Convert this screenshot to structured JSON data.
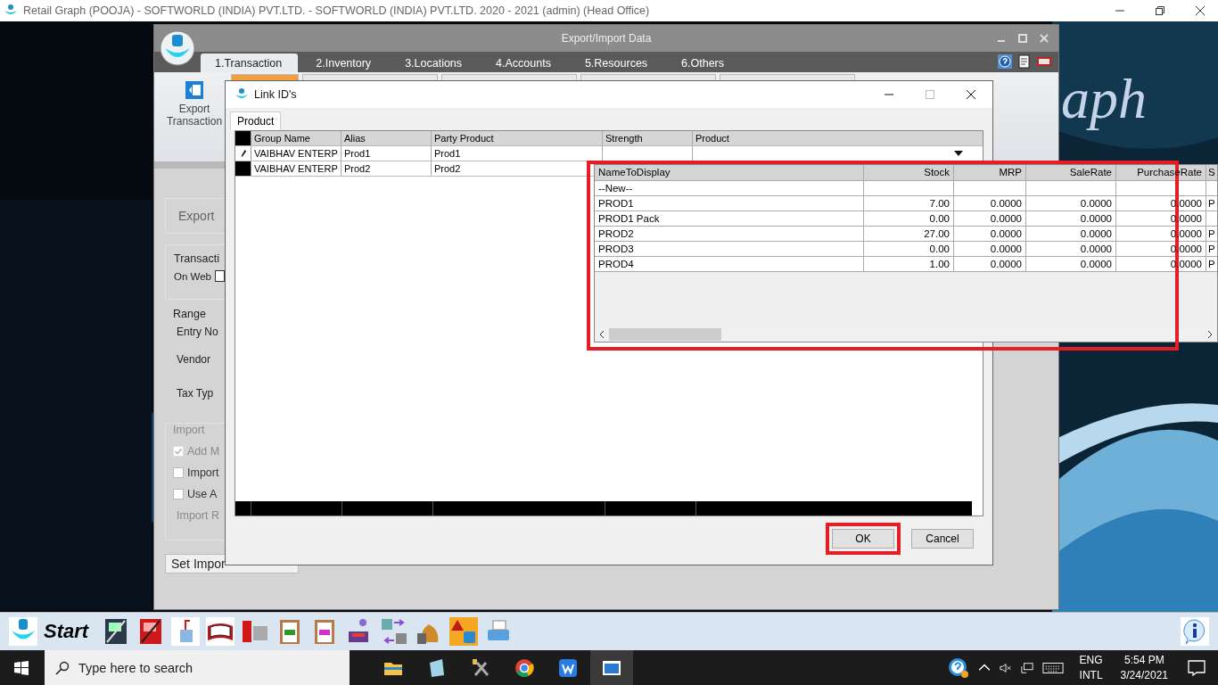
{
  "app_title": "Retail Graph (POOJA) - SOFTWORLD (INDIA) PVT.LTD. - SOFTWORLD (INDIA) PVT.LTD.  2020 - 2021 (admin) (Head Office)",
  "wallpaper_text": "aph",
  "main_window": {
    "title": "Export/Import Data",
    "tabs": [
      {
        "label": "1.Transaction",
        "selected": true
      },
      {
        "label": "2.Inventory",
        "selected": false
      },
      {
        "label": "3.Locations",
        "selected": false
      },
      {
        "label": "4.Accounts",
        "selected": false
      },
      {
        "label": "5.Resources",
        "selected": false
      },
      {
        "label": "6.Others",
        "selected": false
      }
    ],
    "ribbon_groups": [
      {
        "selected": true
      },
      {
        "selected": false
      },
      {
        "selected": false
      },
      {
        "selected": false
      },
      {
        "selected": false
      }
    ],
    "ribbon_button": "Export Transaction",
    "panel": {
      "export_label": "Export",
      "transaction_title": "Transacti",
      "on_web": {
        "label": "On Web",
        "checked": false
      },
      "range_title": "Range",
      "range_labels": [
        "Entry No",
        "Vendor",
        "Tax Typ"
      ],
      "import_title": "Import",
      "import_options": [
        {
          "label": "Add M",
          "checked": true,
          "disabled": true
        },
        {
          "label": "Import",
          "checked": false,
          "disabled": false
        },
        {
          "label": "Use A",
          "checked": false,
          "disabled": false
        }
      ],
      "import_note": "Import R",
      "set_button": "Set Impor"
    }
  },
  "dialog": {
    "title": "Link ID's",
    "tabs": [
      {
        "label": "Product",
        "selected": true
      }
    ],
    "columns": [
      "Group Name",
      "Alias",
      "Party Product",
      "Strength",
      "Product"
    ],
    "rows": [
      {
        "group_name": "VAIBHAV ENTERP",
        "alias": "Prod1",
        "party_product": "Prod1",
        "editing": true
      },
      {
        "group_name": "VAIBHAV ENTERP",
        "alias": "Prod2",
        "party_product": "Prod2",
        "editing": false
      }
    ],
    "buttons": [
      {
        "label": "OK",
        "highlighted": true
      },
      {
        "label": "Cancel",
        "highlighted": false
      }
    ]
  },
  "dropdown": {
    "highlighted": true,
    "columns": [
      "NameToDisplay",
      "Stock",
      "MRP",
      "SaleRate",
      "PurchaseRate",
      "S"
    ],
    "rows": [
      [
        "--New--"
      ],
      [
        "PROD1",
        "7.00",
        "0.0000",
        "0.0000",
        "0.0000",
        "P"
      ],
      [
        "PROD1 Pack",
        "0.00",
        "0.0000",
        "0.0000",
        "0.0000"
      ],
      [
        "PROD2",
        "27.00",
        "0.0000",
        "0.0000",
        "0.0000",
        "P"
      ],
      [
        "PROD3",
        "0.00",
        "0.0000",
        "0.0000",
        "0.0000",
        "P"
      ],
      [
        "PROD4",
        "1.00",
        "0.0000",
        "0.0000",
        "0.0000",
        "P"
      ]
    ]
  },
  "toolbar": {
    "start_label": "Start"
  },
  "taskbar": {
    "search_placeholder": "Type here to search",
    "language": "ENG",
    "layout": "INTL",
    "time": "5:54 PM",
    "date": "3/24/2021"
  }
}
